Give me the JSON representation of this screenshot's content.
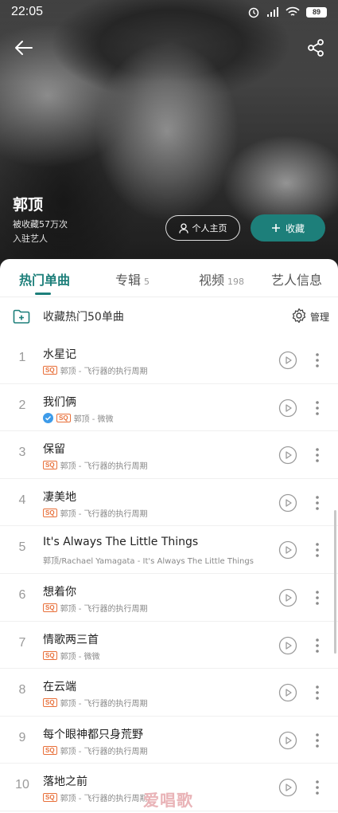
{
  "status_bar": {
    "time": "22:05",
    "battery": "89"
  },
  "artist": {
    "name": "郭顶",
    "fav_count": "被收藏57万次",
    "settled": "入驻艺人"
  },
  "buttons": {
    "profile": "个人主页",
    "collect": "收藏"
  },
  "tabs": [
    {
      "label": "热门单曲",
      "count": ""
    },
    {
      "label": "专辑",
      "count": "5"
    },
    {
      "label": "视频",
      "count": "198"
    },
    {
      "label": "艺人信息",
      "count": ""
    }
  ],
  "actions": {
    "collect_all": "收藏热门50单曲",
    "manage": "管理"
  },
  "songs": [
    {
      "index": "1",
      "title": "水星记",
      "subtitle": "郭顶 - 飞行器的执行周期",
      "sq": true,
      "verified": false
    },
    {
      "index": "2",
      "title": "我们俩",
      "subtitle": "郭顶 - 微微",
      "sq": true,
      "verified": true
    },
    {
      "index": "3",
      "title": "保留",
      "subtitle": "郭顶 - 飞行器的执行周期",
      "sq": true,
      "verified": false
    },
    {
      "index": "4",
      "title": "凄美地",
      "subtitle": "郭顶 - 飞行器的执行周期",
      "sq": true,
      "verified": false
    },
    {
      "index": "5",
      "title": "It's Always The Little Things",
      "subtitle": "郭顶/Rachael Yamagata - It's Always The Little Things",
      "sq": false,
      "verified": false
    },
    {
      "index": "6",
      "title": "想着你",
      "subtitle": "郭顶 - 飞行器的执行周期",
      "sq": true,
      "verified": false
    },
    {
      "index": "7",
      "title": "情歌两三首",
      "subtitle": "郭顶 - 微微",
      "sq": true,
      "verified": false
    },
    {
      "index": "8",
      "title": "在云端",
      "subtitle": "郭顶 - 飞行器的执行周期",
      "sq": true,
      "verified": false
    },
    {
      "index": "9",
      "title": "每个眼神都只身荒野",
      "subtitle": "郭顶 - 飞行器的执行周期",
      "sq": true,
      "verified": false
    },
    {
      "index": "10",
      "title": "落地之前",
      "subtitle": "郭顶 - 飞行器的执行周期",
      "sq": true,
      "verified": false
    }
  ],
  "sq_badge": "SQ",
  "watermark": "爱唱歌",
  "colors": {
    "accent": "#1d7f7a",
    "sq_badge": "#e8703a",
    "verified": "#3d9be9"
  }
}
